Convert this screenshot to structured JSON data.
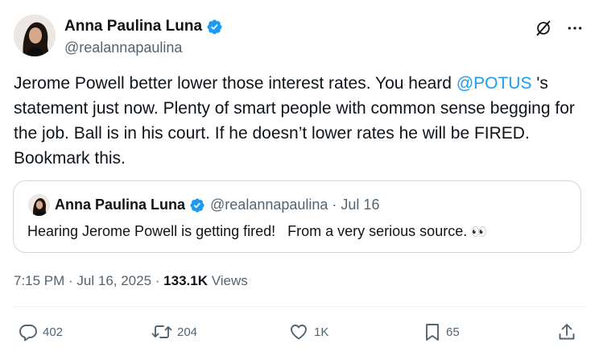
{
  "author": {
    "name": "Anna Paulina Luna",
    "handle": "@realannapaulina"
  },
  "tweet": {
    "text_part1": "Jerome Powell better lower those interest rates. You heard ",
    "mention": "@POTUS",
    "text_part2": " 's statement just now. Plenty of smart people with common sense begging for the job. Ball is in his court. If he doesn’t lower rates he will be FIRED. Bookmark this."
  },
  "quote": {
    "name": "Anna Paulina Luna",
    "handle": "@realannapaulina",
    "separator": " · ",
    "date": "Jul 16",
    "text": "Hearing Jerome Powell is getting fired!   From a very serious source. ",
    "emoji": "👀"
  },
  "meta": {
    "time": "7:15 PM",
    "sep1": " · ",
    "date": "Jul 16, 2025",
    "sep2": " · ",
    "views_count": "133.1K",
    "views_label": " Views"
  },
  "actions": {
    "replies": "402",
    "reposts": "204",
    "likes": "1K",
    "bookmarks": "65"
  },
  "colors": {
    "accent": "#1d9bf0",
    "text": "#0f1419",
    "muted": "#536471",
    "border": "#cfd9de"
  },
  "icons": {
    "avatar": "avatar-photo",
    "verified": "verified-badge-icon",
    "grok": "grok-icon",
    "more": "more-options-icon",
    "reply": "reply-icon",
    "repost": "repost-icon",
    "like": "heart-icon",
    "bookmark": "bookmark-icon",
    "share": "share-icon"
  }
}
